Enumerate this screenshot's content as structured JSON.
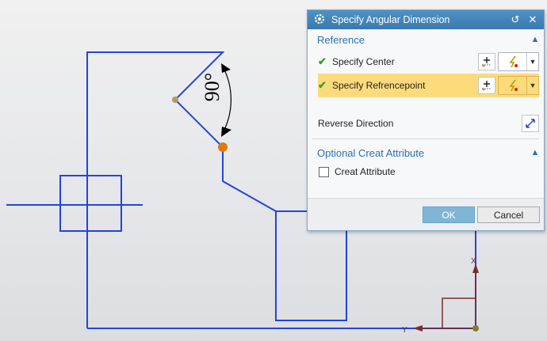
{
  "dialog": {
    "title": "Specify Angular Dimension",
    "reference": {
      "header": "Reference",
      "rows": [
        {
          "label": "Specify Center",
          "status": "complete"
        },
        {
          "label": "Specify Refrencepoint",
          "status": "complete",
          "selected": true
        }
      ],
      "reverse_direction_label": "Reverse Direction"
    },
    "optional": {
      "header": "Optional Creat Attribute",
      "create_attribute_label": "Creat Attribute",
      "create_attribute_checked": false
    },
    "ok_label": "OK",
    "cancel_label": "Cancel"
  },
  "sketch": {
    "angle_text": "90°",
    "csys_labels": {
      "x": "X",
      "y": "Y"
    },
    "colors": {
      "curve": "#2244dd",
      "dimension": "#000000",
      "point": "#e27a10",
      "center": "#b89a5a",
      "csys": "#7a2b2b"
    }
  },
  "colors": {
    "accent": "#3a79ad",
    "selected_row": "#fddb7b",
    "check": "#2fa12f",
    "ok_button": "#7fb6d6"
  }
}
